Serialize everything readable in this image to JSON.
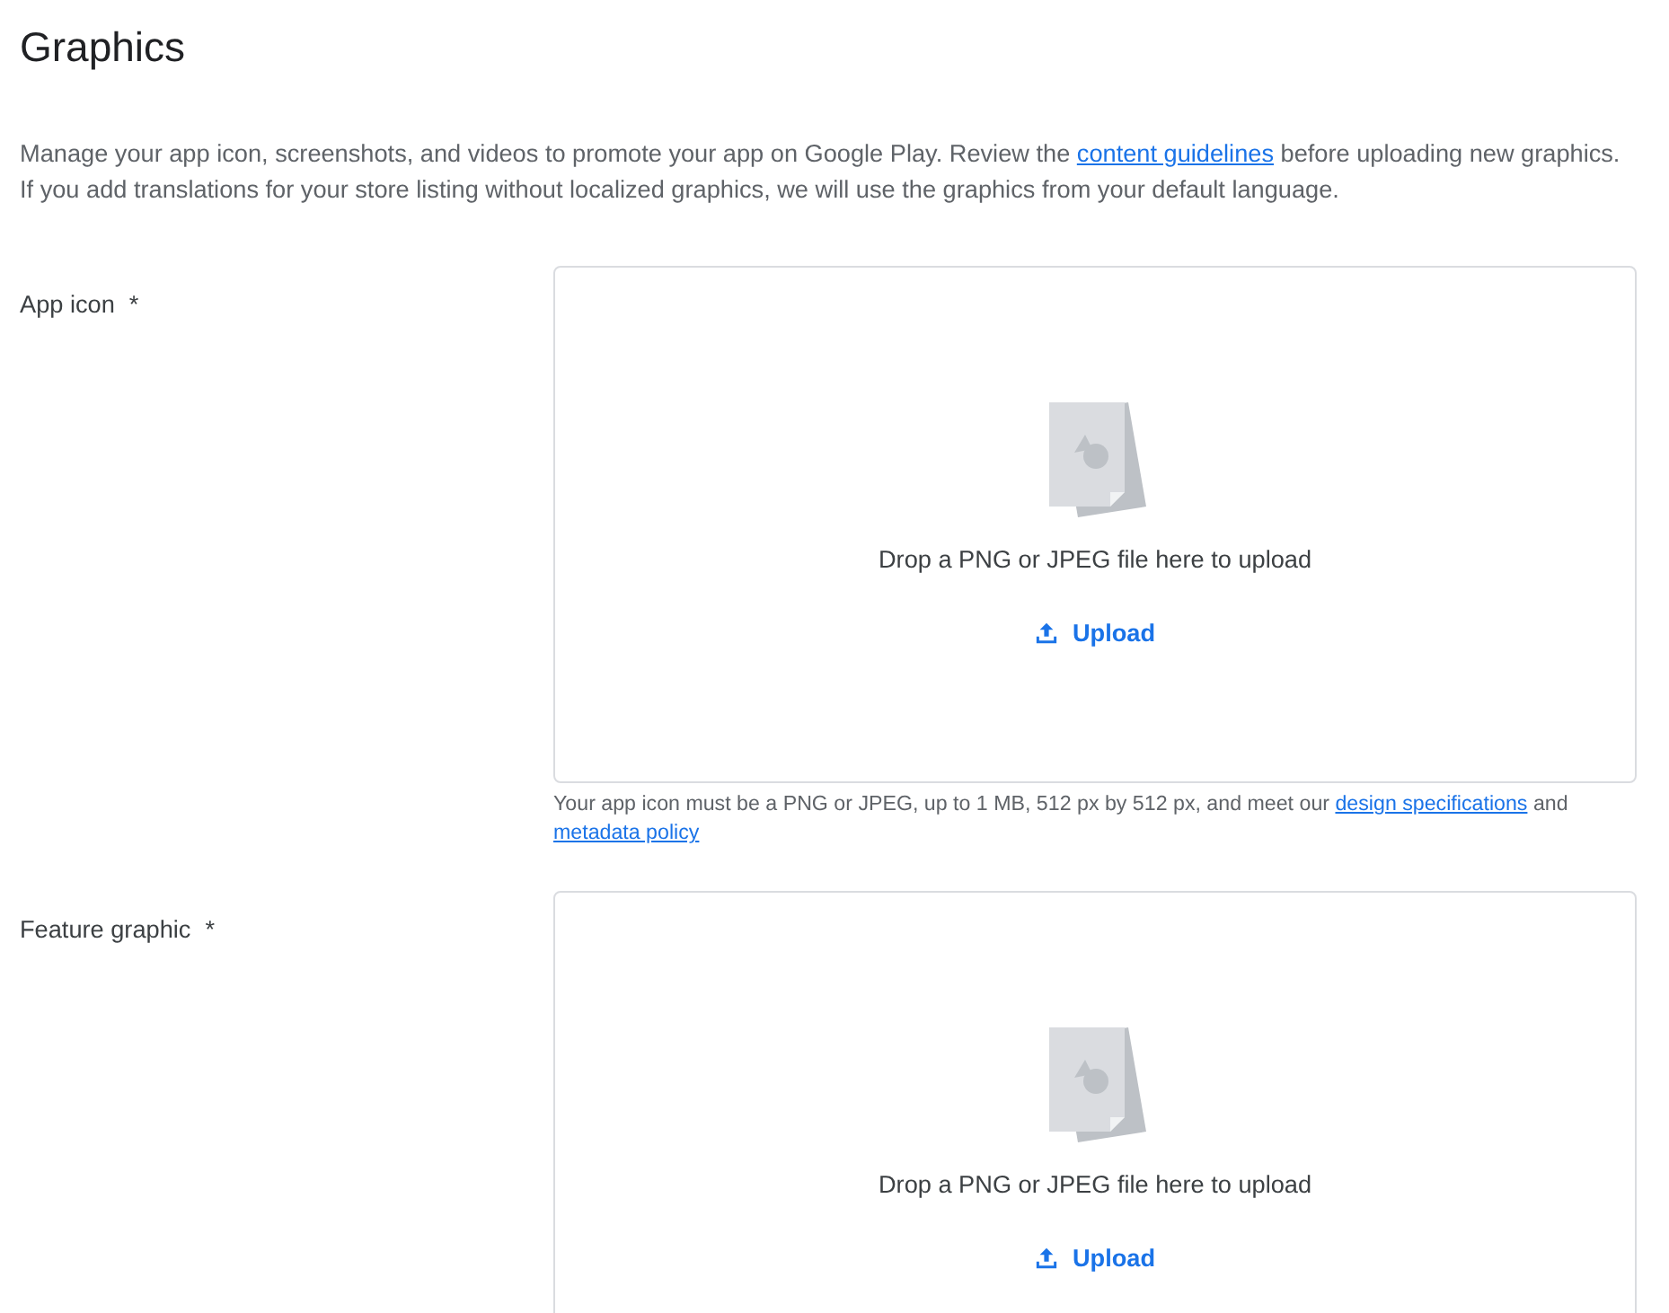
{
  "title": "Graphics",
  "description": [
    {
      "kind": "text",
      "text": "Manage your app icon, screenshots, and videos to promote your app on Google Play. Review the "
    },
    {
      "kind": "link",
      "text": "content guidelines"
    },
    {
      "kind": "text",
      "text": " before uploading new graphics. If you add translations for your store listing without localized graphics, we will use the graphics from your default language."
    }
  ],
  "fields": [
    {
      "label": "App icon",
      "required_mark": "*",
      "drop_text": "Drop a PNG or JPEG file here to upload",
      "upload_label": "Upload",
      "help": [
        {
          "kind": "text",
          "text": "Your app icon must be a PNG or JPEG, up to 1 MB, 512 px by 512 px, and meet our "
        },
        {
          "kind": "link",
          "text": "design specifications"
        },
        {
          "kind": "text",
          "text": " and "
        },
        {
          "kind": "link",
          "text": "metadata policy"
        }
      ]
    },
    {
      "label": "Feature graphic",
      "required_mark": "*",
      "drop_text": "Drop a PNG or JPEG file here to upload",
      "upload_label": "Upload"
    }
  ]
}
